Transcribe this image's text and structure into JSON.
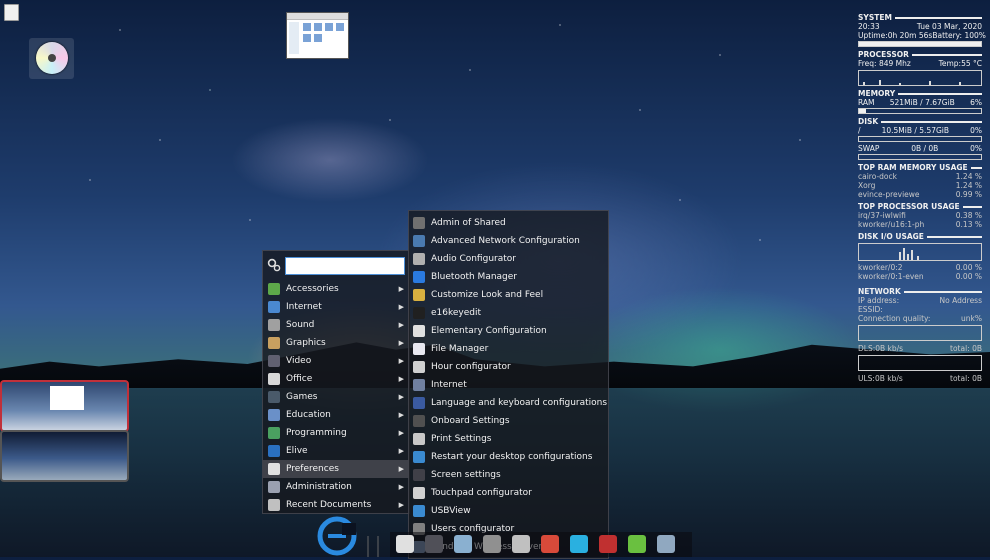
{
  "menu": {
    "search_value": "",
    "categories": [
      {
        "label": "Accessories",
        "icon": "accessories-icon",
        "color": "#5da84a",
        "highlight": false
      },
      {
        "label": "Internet",
        "icon": "internet-globe-icon",
        "color": "#4a88d0",
        "highlight": false
      },
      {
        "label": "Sound",
        "icon": "sound-icon",
        "color": "#a0a0a0",
        "highlight": false
      },
      {
        "label": "Graphics",
        "icon": "graphics-brush-icon",
        "color": "#c8a060",
        "highlight": false
      },
      {
        "label": "Video",
        "icon": "video-icon",
        "color": "#606070",
        "highlight": false
      },
      {
        "label": "Office",
        "icon": "office-icon",
        "color": "#d8d8d8",
        "highlight": false
      },
      {
        "label": "Games",
        "icon": "games-icon",
        "color": "#4a5a6a",
        "highlight": false
      },
      {
        "label": "Education",
        "icon": "education-icon",
        "color": "#6a90c8",
        "highlight": false
      },
      {
        "label": "Programming",
        "icon": "programming-icon",
        "color": "#4aa060",
        "highlight": false
      },
      {
        "label": "Elive",
        "icon": "elive-icon",
        "color": "#2a70c0",
        "highlight": false
      },
      {
        "label": "Preferences",
        "icon": "preferences-icon",
        "color": "#e0e0e0",
        "highlight": true
      },
      {
        "label": "Administration",
        "icon": "administration-icon",
        "color": "#9aa0b0",
        "highlight": false
      },
      {
        "label": "Recent Documents",
        "icon": "recent-documents-icon",
        "color": "#c0c0c0",
        "highlight": false
      }
    ],
    "preferences": [
      {
        "label": "Admin of Shared",
        "icon": "admin-shared-icon",
        "color": "#707070"
      },
      {
        "label": "Advanced Network Configuration",
        "icon": "network-config-icon",
        "color": "#4a7ab0"
      },
      {
        "label": "Audio Configurator",
        "icon": "audio-icon",
        "color": "#b0b0b0"
      },
      {
        "label": "Bluetooth Manager",
        "icon": "bluetooth-icon",
        "color": "#2a7ae0"
      },
      {
        "label": "Customize Look and Feel",
        "icon": "look-feel-icon",
        "color": "#d8b040"
      },
      {
        "label": "e16keyedit",
        "icon": "e16keyedit-icon",
        "color": "#202020"
      },
      {
        "label": "Elementary Configuration",
        "icon": "elementary-config-icon",
        "color": "#e0e0e0"
      },
      {
        "label": "File Manager",
        "icon": "file-manager-icon",
        "color": "#e8e8f0"
      },
      {
        "label": "Hour configurator",
        "icon": "clock-icon",
        "color": "#d0d0d0"
      },
      {
        "label": "Internet",
        "icon": "internet-icon",
        "color": "#7080a0"
      },
      {
        "label": "Language and keyboard configurations",
        "icon": "language-icon",
        "color": "#3a5aa0"
      },
      {
        "label": "Onboard Settings",
        "icon": "onboard-keyboard-icon",
        "color": "#505050"
      },
      {
        "label": "Print Settings",
        "icon": "printer-icon",
        "color": "#c8c8c8"
      },
      {
        "label": "Restart your desktop configurations",
        "icon": "restart-icon",
        "color": "#3a8ad0"
      },
      {
        "label": "Screen settings",
        "icon": "screen-icon",
        "color": "#404048"
      },
      {
        "label": "Touchpad configurator",
        "icon": "touchpad-icon",
        "color": "#d0d0d0"
      },
      {
        "label": "USBView",
        "icon": "usb-icon",
        "color": "#3a8ad0"
      },
      {
        "label": "Users configurator",
        "icon": "users-icon",
        "color": "#808080"
      },
      {
        "label": "Windows Wireless Drivers",
        "icon": "wireless-drivers-icon",
        "color": "#7a90b0"
      }
    ]
  },
  "conky": {
    "system": {
      "title": "SYSTEM",
      "time": "20:33",
      "date": "Tue 03 Mar, 2020",
      "uptime": "Uptime:0h 20m 56s",
      "battery": "Battery: 100%",
      "battery_level": 1.0
    },
    "processor": {
      "title": "PROCESSOR",
      "freq": "Freq: 849 Mhz",
      "temp": "Temp:55 °C"
    },
    "memory": {
      "title": "MEMORY",
      "label": "RAM",
      "value": "521MiB / 7.67GiB",
      "pct": "6%",
      "level": 0.06
    },
    "disk": {
      "title": "DISK",
      "label": "/",
      "value": "10.5MiB / 5.57GiB",
      "pct": "0%",
      "level": 0.0
    },
    "swap": {
      "label": "SWAP",
      "value": "0B / 0B",
      "pct": "0%",
      "level": 0.0
    },
    "top_ram": {
      "title": "TOP RAM MEMORY USAGE",
      "rows": [
        {
          "name": "cairo-dock",
          "value": "1.24 %"
        },
        {
          "name": "Xorg",
          "value": "1.24 %"
        },
        {
          "name": "evince-previewe",
          "value": "0.99 %"
        }
      ]
    },
    "top_cpu": {
      "title": "TOP PROCESSOR USAGE",
      "rows": [
        {
          "name": "irq/37-iwlwifi",
          "value": "0.38 %"
        },
        {
          "name": "kworker/u16:1-ph",
          "value": "0.13 %"
        }
      ]
    },
    "disk_io": {
      "title": "DISK I/O USAGE",
      "rows": [
        {
          "name": "kworker/0:2",
          "value": "0.00 %"
        },
        {
          "name": "kworker/0:1-even",
          "value": "0.00 %"
        }
      ]
    },
    "network": {
      "title": "NETWORK",
      "ip_label": "IP address:",
      "ip_value": "No Address",
      "essid_label": "ESSID:",
      "quality_label": "Connection quality:",
      "quality_value": "unk%",
      "dl_label": "DLS:0B   kb/s",
      "dl_total": "total: 0B",
      "ul_label": "ULS:0B   kb/s",
      "ul_total": "total: 0B"
    }
  },
  "dock_icons": [
    "home-icon",
    "terminal-icon",
    "files-icon",
    "recycle-icon",
    "battery-icon",
    "lifebuoy-icon",
    "wifi-icon",
    "exit-icon",
    "download-icon",
    "trash-icon"
  ]
}
